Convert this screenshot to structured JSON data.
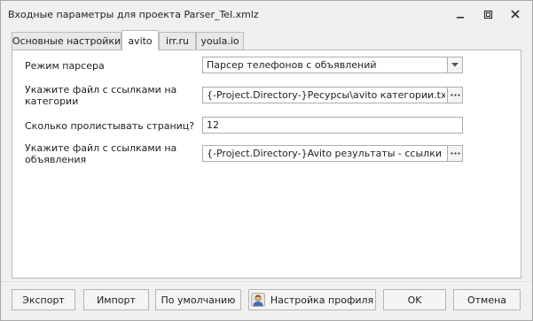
{
  "window": {
    "title": "Входные параметры для проекта Parser_Tel.xmlz"
  },
  "tabs": [
    {
      "label": "Основные настройки",
      "active": false
    },
    {
      "label": "avito",
      "active": true
    },
    {
      "label": "irr.ru",
      "active": false
    },
    {
      "label": "youla.io",
      "active": false
    }
  ],
  "form": {
    "parser_mode": {
      "label": "Режим парсера",
      "value": "Парсер телефонов с объявлений"
    },
    "categories_file": {
      "label": "Укажите файл с ссылками на категории",
      "value": "{-Project.Directory-}Ресурсы\\avito категории.txt"
    },
    "pages_count": {
      "label": "Сколько пролистывать страниц?",
      "value": "12"
    },
    "ads_file": {
      "label": "Укажите файл с ссылками на объявления",
      "value": "{-Project.Directory-}Avito результаты - ссылки на объявления.txt"
    }
  },
  "buttons": {
    "export": "Экспорт",
    "import": "Импорт",
    "default": "По умолчанию",
    "profile": "Настройка профиля",
    "ok": "OK",
    "cancel": "Отмена"
  },
  "icons": {
    "minimize": "minimize-icon",
    "maximize": "maximize-icon",
    "close": "close-icon",
    "dropdown": "chevron-down-icon",
    "browse": "ellipsis-icon",
    "profile": "user-profile-icon"
  }
}
